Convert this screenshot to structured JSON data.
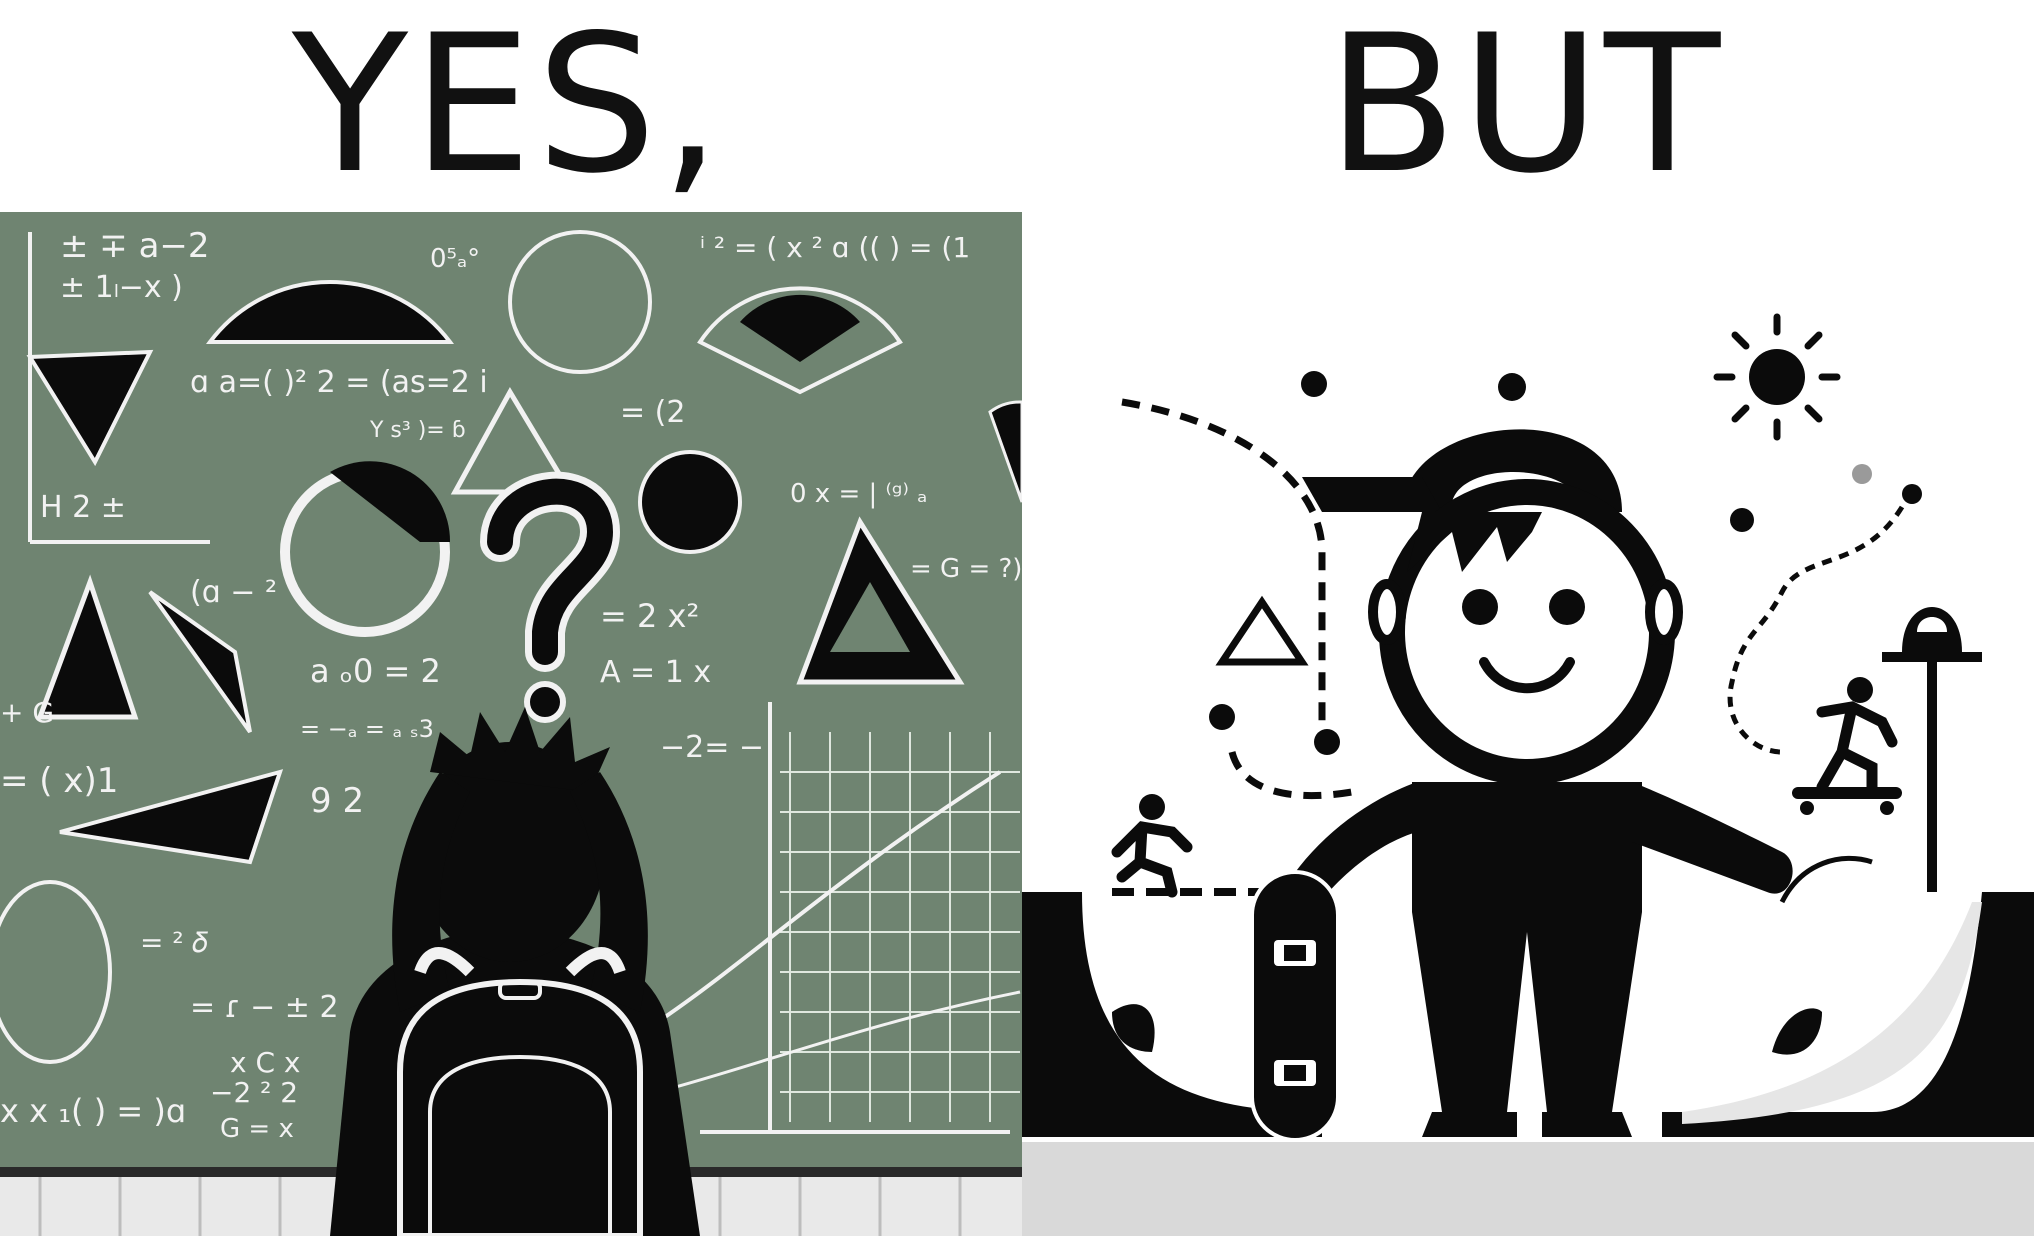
{
  "headings": {
    "left": "YES,",
    "right": "BUT"
  },
  "colors": {
    "chalkboard": "#6f8471",
    "chalk": "#f2f2f2",
    "ink": "#0b0b0b",
    "floor": "#d9d9d9",
    "wall": "#ffffff"
  },
  "chalkboard": {
    "scribbles": [
      "± ∓ a−2",
      "± 1ₗ−x )",
      "0⁵ₐ°",
      "ⁱ ² = ( x ² ɑ (( ) = (1",
      "ɑ a=( )² 2 = (as=2  i",
      "Y  s³ )=  ɓ",
      "H 2 ±",
      "= (2",
      "0 x = | ⁽ᵍ⁾ ₐ",
      "= G = ?)",
      "(ɑ − ²",
      "= 2 x²",
      "a  ₒ0 = 2",
      "A = 1 x",
      "=  −ₐ =  ₐ  ₛ3",
      "= ( x)1",
      "9 2",
      "−2= −",
      "= ɾ − ± 2",
      "x x ₁( ) = )ɑ",
      "−2 ² 2",
      "G = x",
      "+ G",
      "= ²  𝛿",
      "x C  x"
    ]
  },
  "icons": [
    "question-mark-icon",
    "sun-icon",
    "skateboarder-icon",
    "runner-icon",
    "skateboard-icon",
    "street-lamp-icon",
    "leaf-icon"
  ]
}
